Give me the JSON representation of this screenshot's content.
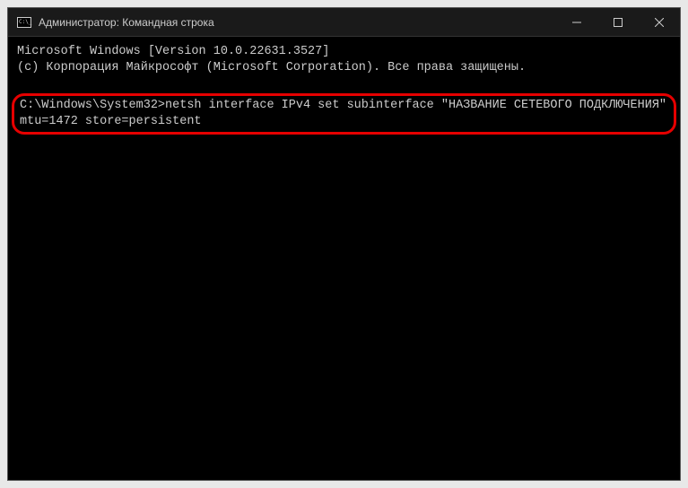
{
  "titlebar": {
    "title": "Администратор: Командная строка"
  },
  "terminal": {
    "line1": "Microsoft Windows [Version 10.0.22631.3527]",
    "line2": "(c) Корпорация Майкрософт (Microsoft Corporation). Все права защищены.",
    "prompt": "C:\\Windows\\System32>",
    "command": "netsh interface IPv4 set subinterface \"НАЗВАНИЕ СЕТЕВОГО ПОДКЛЮЧЕНИЯ\" mtu=1472 store=persistent"
  }
}
